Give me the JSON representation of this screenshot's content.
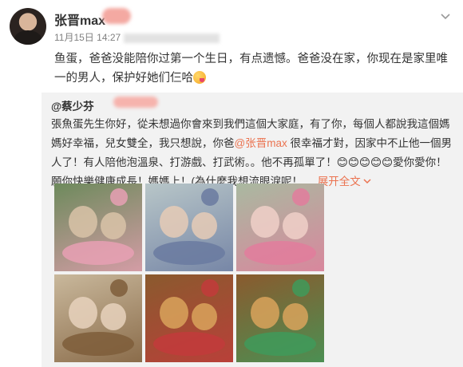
{
  "post": {
    "author": "张晋max",
    "time": "11月15日 14:27",
    "text": "鱼蛋，爸爸没能陪你过第一个生日，有点遗憾。爸爸没在家，你现在是家里唯一的男人，保护好她们仨哈",
    "menu_icon": "chevron-down-icon"
  },
  "repost": {
    "author": "@蔡少芬",
    "text_before": "張魚蛋先生你好，從未想過你會來到我們這個大家庭，有了你，每個人都說我這個媽媽好幸福，兒女雙全，我只想說，你爸",
    "mention": "@张晋max",
    "text_after": " 很幸福才對，因家中不止他一個男人了！有人陪他泡溫泉、打游戲、打武術。。他不再孤單了！😊😊😊😊😊愛你愛你！願你快樂健康成長！媽媽上！(為什麼我想流眼淚呢！ ... ",
    "expand": "展开全文",
    "expand_icon": "chevron-down-icon"
  },
  "photos": [
    {
      "name": "photo-family-cake",
      "palette": [
        "#6d8a5c",
        "#d9c3a8",
        "#e8a0b4"
      ]
    },
    {
      "name": "photo-mother-kiss",
      "palette": [
        "#b8c6c8",
        "#e6cbb6",
        "#6a7aa0"
      ]
    },
    {
      "name": "photo-sisters-kiss",
      "palette": [
        "#a9b9a0",
        "#f0d0c8",
        "#e27d9c"
      ]
    },
    {
      "name": "photo-baby-cake",
      "palette": [
        "#c9b89c",
        "#e8d2bd",
        "#7e5d3a"
      ]
    },
    {
      "name": "photo-dinosaur-cake",
      "palette": [
        "#8a5a2e",
        "#d9a35c",
        "#c23b3b"
      ]
    },
    {
      "name": "photo-dinosaur-cake-2",
      "palette": [
        "#8a5a2e",
        "#d9a35c",
        "#3f9a5a"
      ]
    }
  ],
  "colors": {
    "link": "#eb7350",
    "repost_bg": "#f2f2f2",
    "meta": "#808080"
  }
}
